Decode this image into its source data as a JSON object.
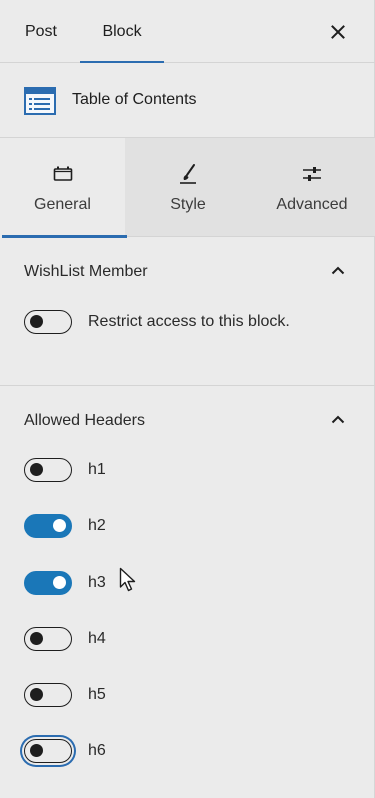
{
  "tabs": {
    "post": "Post",
    "block": "Block"
  },
  "block": {
    "title": "Table of Contents"
  },
  "inspector": {
    "general": "General",
    "style": "Style",
    "advanced": "Advanced"
  },
  "wishlist": {
    "title": "WishList Member",
    "restrict_label": "Restrict access to this block.",
    "restrict_on": false
  },
  "allowed_headers": {
    "title": "Allowed Headers",
    "items": [
      {
        "label": "h1",
        "on": false
      },
      {
        "label": "h2",
        "on": true
      },
      {
        "label": "h3",
        "on": true
      },
      {
        "label": "h4",
        "on": false
      },
      {
        "label": "h5",
        "on": false
      },
      {
        "label": "h6",
        "on": false,
        "focused": true
      }
    ]
  },
  "colors": {
    "accent": "#1a77b8",
    "tab_indicator": "#2b6cb0"
  }
}
